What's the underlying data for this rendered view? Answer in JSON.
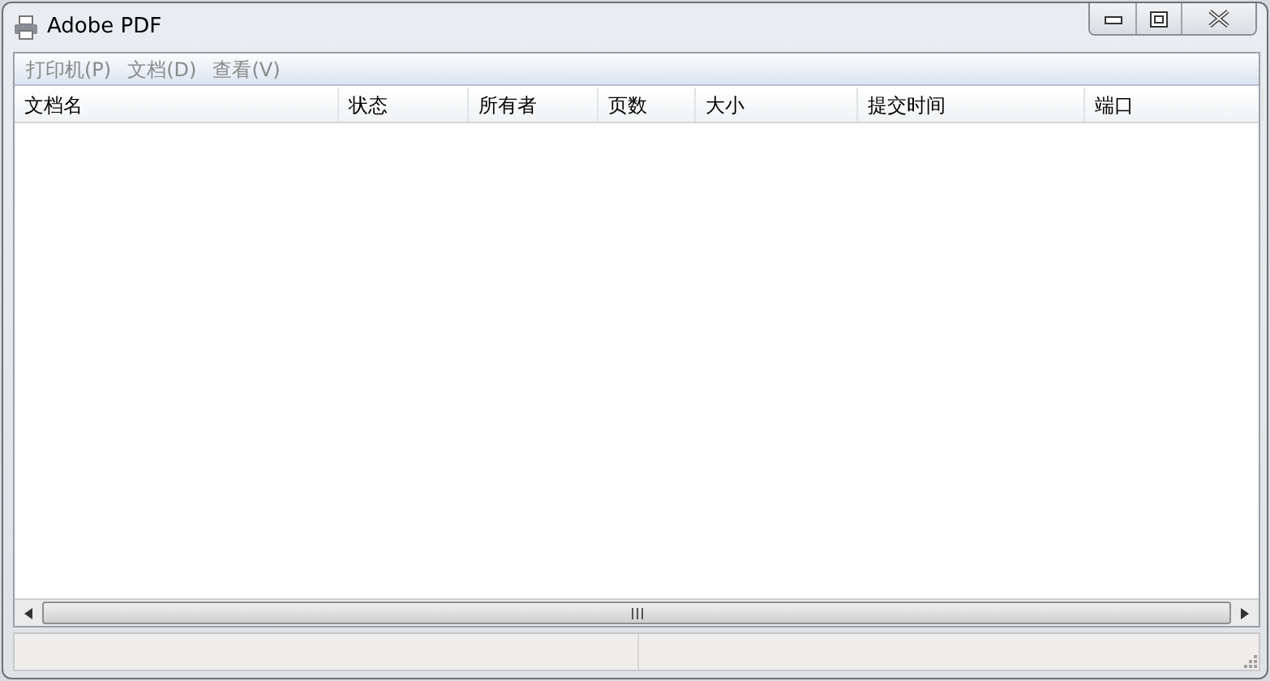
{
  "window": {
    "title": "Adobe PDF"
  },
  "menu": [
    {
      "label": "打印机(P)",
      "disabled": true
    },
    {
      "label": "文档(D)",
      "disabled": true
    },
    {
      "label": "查看(V)",
      "disabled": true
    }
  ],
  "table": {
    "columns": [
      "文档名",
      "状态",
      "所有者",
      "页数",
      "大小",
      "提交时间",
      "端口"
    ]
  }
}
